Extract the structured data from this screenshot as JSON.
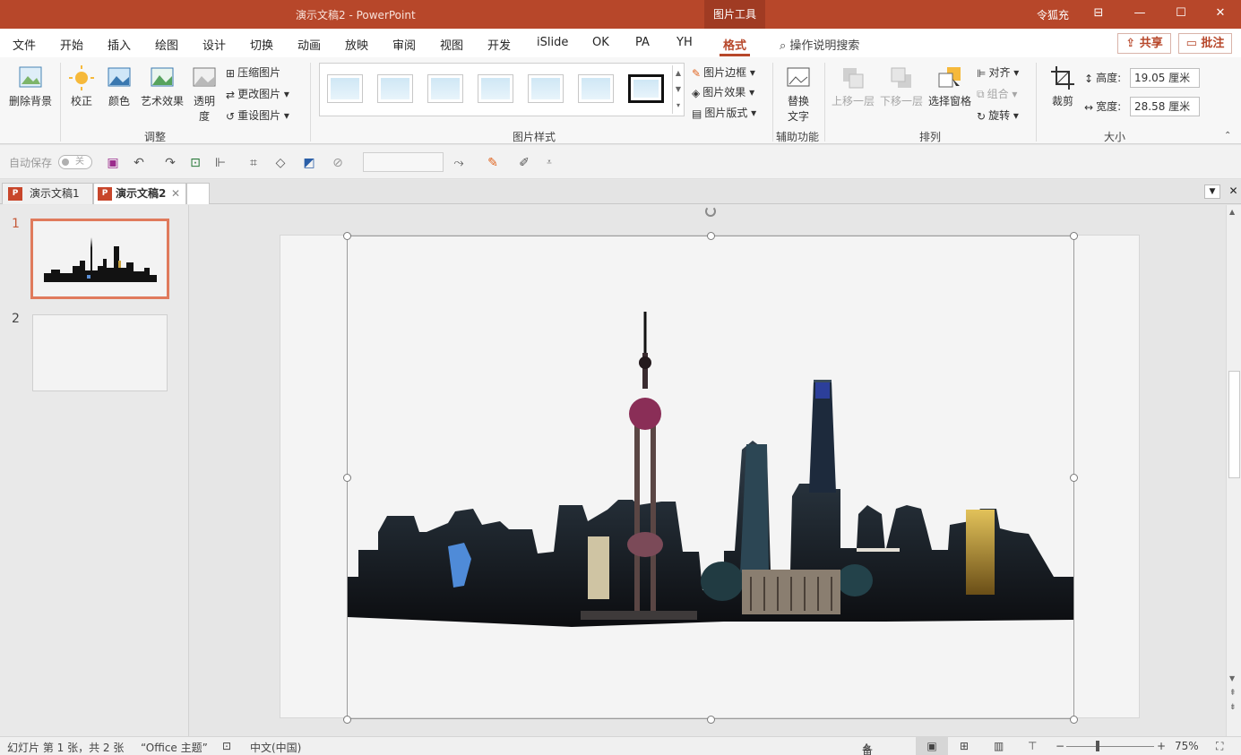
{
  "titlebar": {
    "doc_title": "演示文稿2  -  PowerPoint",
    "context_tool": "图片工具",
    "user": "令狐充",
    "restore_label": "⊟",
    "minimize_label": "—",
    "maximize_label": "☐",
    "close_label": "✕"
  },
  "menu": {
    "tabs": [
      "文件",
      "开始",
      "插入",
      "绘图",
      "设计",
      "切换",
      "动画",
      "放映",
      "审阅",
      "视图",
      "开发",
      "iSlide",
      "OK",
      "PA",
      "YH",
      "格式"
    ],
    "active_tab": "格式",
    "search_placeholder": "操作说明搜索",
    "share": "共享",
    "comments": "批注"
  },
  "ribbon": {
    "adjust": {
      "remove_bg": "删除背景",
      "corrections": "校正",
      "color": "颜色",
      "artistic": "艺术效果",
      "transparency_1": "透明",
      "transparency_2": "度",
      "compress": "压缩图片",
      "change": "更改图片",
      "reset": "重设图片",
      "group_label": "调整"
    },
    "styles": {
      "border": "图片边框",
      "effects": "图片效果",
      "layout": "图片版式",
      "group_label": "图片样式"
    },
    "accessibility": {
      "alt_text_1": "替换",
      "alt_text_2": "文字",
      "group_label": "辅助功能"
    },
    "arrange": {
      "bring_forward": "上移一层",
      "send_backward": "下移一层",
      "selection_pane": "选择窗格",
      "align": "对齐",
      "group": "组合",
      "rotate": "旋转",
      "group_label": "排列"
    },
    "size": {
      "crop": "裁剪",
      "height_label": "高度:",
      "height_value": "19.05 厘米",
      "width_label": "宽度:",
      "width_value": "28.58 厘米",
      "group_label": "大小"
    }
  },
  "qat": {
    "autosave": "自动保存",
    "autosave_state": "关"
  },
  "doc_tabs": [
    "演示文稿1",
    "演示文稿2"
  ],
  "doc_tab_icon": "P",
  "slides": [
    {
      "number": "1"
    },
    {
      "number": "2"
    }
  ],
  "status": {
    "slide_info": "幻灯片 第 1 张，共 2 张",
    "theme": "“Office 主题”",
    "language": "中文(中国)",
    "notes": "备注",
    "zoom": "75%"
  },
  "colors": {
    "accent": "#b7472a",
    "selection_border": "#e07a5c"
  }
}
